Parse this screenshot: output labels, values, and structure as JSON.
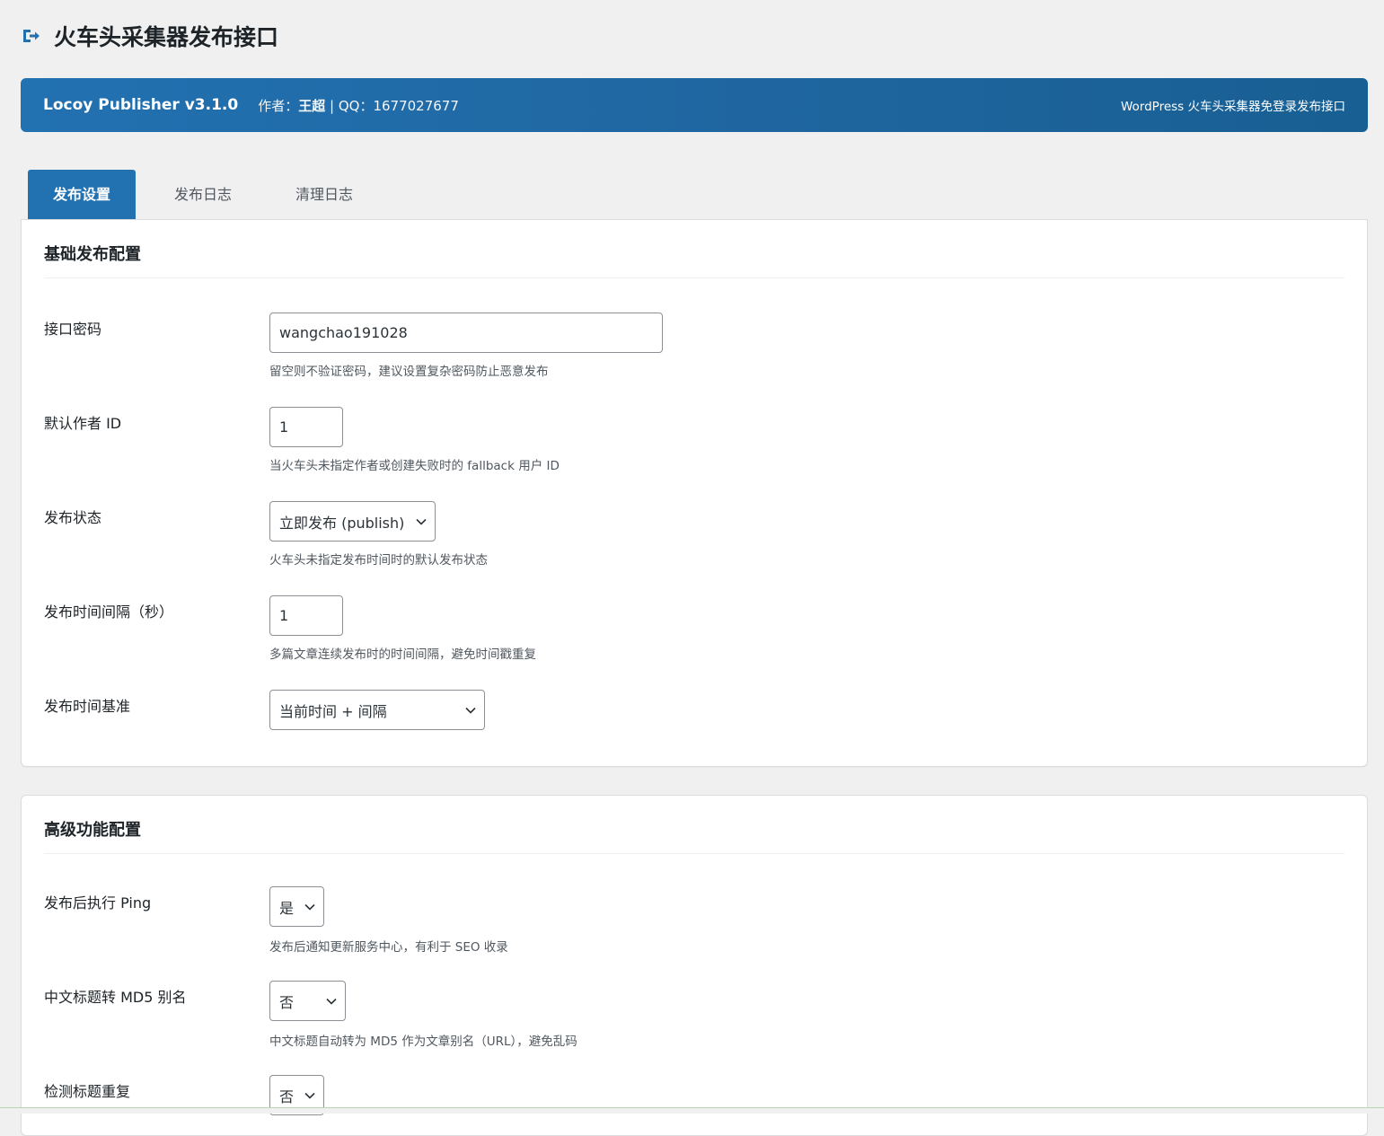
{
  "page": {
    "title": "火车头采集器发布接口",
    "title_icon": "exit-arrow-icon"
  },
  "banner": {
    "plugin_name": "Locoy Publisher v3.1.0",
    "author_prefix": "作者：",
    "author_name": "王超",
    "qq_text": " | QQ：1677027677",
    "tagline": "WordPress 火车头采集器免登录发布接口",
    "colors": {
      "background": "#2271b1",
      "text": "#ffffff"
    }
  },
  "tabs": [
    {
      "label": "发布设置",
      "active": true
    },
    {
      "label": "发布日志",
      "active": false
    },
    {
      "label": "清理日志",
      "active": false
    }
  ],
  "sections": {
    "basic": {
      "title": "基础发布配置",
      "fields": {
        "api_password": {
          "label": "接口密码",
          "value": "wangchao191028",
          "description": "留空则不验证密码，建议设置复杂密码防止恶意发布"
        },
        "default_author": {
          "label": "默认作者 ID",
          "value": "1",
          "description": "当火车头未指定作者或创建失败时的 fallback 用户 ID"
        },
        "publish_status": {
          "label": "发布状态",
          "value": "立即发布 (publish)",
          "description": "火车头未指定发布时间时的默认发布状态"
        },
        "interval": {
          "label": "发布时间间隔（秒）",
          "value": "1",
          "description": "多篇文章连续发布时的时间间隔，避免时间戳重复"
        },
        "time_base": {
          "label": "发布时间基准",
          "value": "当前时间 + 间隔"
        }
      }
    },
    "advanced": {
      "title": "高级功能配置",
      "fields": {
        "ping": {
          "label": "发布后执行 Ping",
          "value": "是",
          "description": "发布后通知更新服务中心，有利于 SEO 收录"
        },
        "md5_slug": {
          "label": "中文标题转 MD5 别名",
          "value": "否",
          "description": "中文标题自动转为 MD5 作为文章别名（URL），避免乱码"
        },
        "dup_check": {
          "label": "检测标题重复",
          "value": "否"
        }
      }
    }
  },
  "colors": {
    "accent": "#2271b1",
    "page_bg": "#f0f0f1",
    "card_bg": "#ffffff",
    "description_text": "#50575e"
  }
}
